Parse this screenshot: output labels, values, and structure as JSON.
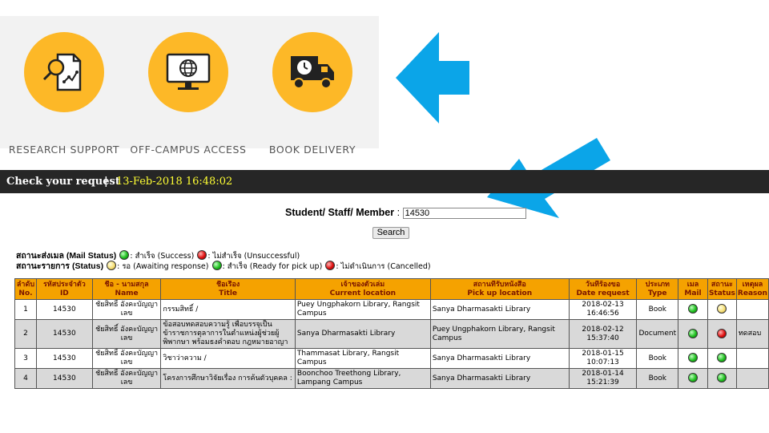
{
  "services": [
    {
      "label": "RESEARCH  SUPPORT",
      "icon": "research-document-magnifier-icon"
    },
    {
      "label": "OFF-CAMPUS  ACCESS",
      "icon": "globe-monitor-icon"
    },
    {
      "label": "BOOK  DELIVERY",
      "icon": "delivery-truck-clock-icon"
    }
  ],
  "colors": {
    "service_circle": "#fdb827",
    "arrow": "#0ba5e8",
    "bar_bg": "#262626",
    "timestamp": "#ffff33",
    "table_header": "#f5a200"
  },
  "request_bar": {
    "title": "Check your request",
    "separator": "|",
    "timestamp": "13-Feb-2018 16:48:02"
  },
  "search": {
    "label": "Student/ Staff/ Member",
    "colon": ":",
    "value": "14530",
    "button": "Search"
  },
  "legend": {
    "mail_label": "สถานะส่งเมล (Mail Status)",
    "mail_success": ": สำเร็จ (Success)",
    "mail_fail": ": ไม่สำเร็จ (Unsuccessful)",
    "status_label": "สถานะรายการ (Status)",
    "status_wait": ": รอ (Awaiting response)",
    "status_ready": ": สำเร็จ (Ready for pick up)",
    "status_cancel": ": ไม่ดำเนินการ (Cancelled)"
  },
  "table": {
    "headers": [
      {
        "th": "ลำดับ",
        "en": "No."
      },
      {
        "th": "รหัสประจำตัว",
        "en": "ID"
      },
      {
        "th": "ชื่อ - นามสกุล",
        "en": "Name"
      },
      {
        "th": "ชื่อเรื่อง",
        "en": "Title"
      },
      {
        "th": "เจ้าของตัวเล่ม",
        "en": "Current location"
      },
      {
        "th": "สถานที่รับหนังสือ",
        "en": "Pick up location"
      },
      {
        "th": "วันที่ร้องขอ",
        "en": "Date request"
      },
      {
        "th": "ประเภท",
        "en": "Type"
      },
      {
        "th": "เมล",
        "en": "Mail"
      },
      {
        "th": "สถานะ",
        "en": "Status"
      },
      {
        "th": "เหตุผล",
        "en": "Reason"
      }
    ],
    "rows": [
      {
        "no": "1",
        "id": "14530",
        "name": "ชัยสิทธิ์ อังคะบัญญาเลข",
        "title": "กรรมสิทธิ์ /",
        "current": "Puey Ungphakorn Library, Rangsit Campus",
        "pickup": "Sanya Dharmasakti Library",
        "date": "2018-02-13",
        "time": "16:46:56",
        "type": "Book",
        "mail": "green",
        "status": "yellow",
        "reason": ""
      },
      {
        "no": "2",
        "id": "14530",
        "name": "ชัยสิทธิ์ อังคะบัญญาเลข",
        "title": "ข้อสอบทดสอบความรู้ เพื่อบรรจุเป็นข้าราชการตุลาการในตำแหน่งผู้ช่วยผู้พิพากษา พร้อมธงคำตอบ กฎหมายอาญา",
        "current": "Sanya Dharmasakti Library",
        "pickup": "Puey Ungphakorn Library, Rangsit Campus",
        "date": "2018-02-12",
        "time": "15:37:40",
        "type": "Document",
        "mail": "green",
        "status": "red",
        "reason": "ทดสอบ"
      },
      {
        "no": "3",
        "id": "14530",
        "name": "ชัยสิทธิ์ อังคะบัญญาเลข",
        "title": "วิชาว่าความ /",
        "current": "Thammasat Library, Rangsit Campus",
        "pickup": "Sanya Dharmasakti Library",
        "date": "2018-01-15",
        "time": "10:07:13",
        "type": "Book",
        "mail": "green",
        "status": "green",
        "reason": ""
      },
      {
        "no": "4",
        "id": "14530",
        "name": "ชัยสิทธิ์ อังคะบัญญาเลข",
        "title": "โครงการศึกษาวิจัยเรื่อง การค้นตัวบุคคล :",
        "current": "Boonchoo Treethong Library, Lampang Campus",
        "pickup": "Sanya Dharmasakti Library",
        "date": "2018-01-14",
        "time": "15:21:39",
        "type": "Book",
        "mail": "green",
        "status": "green",
        "reason": ""
      }
    ]
  }
}
